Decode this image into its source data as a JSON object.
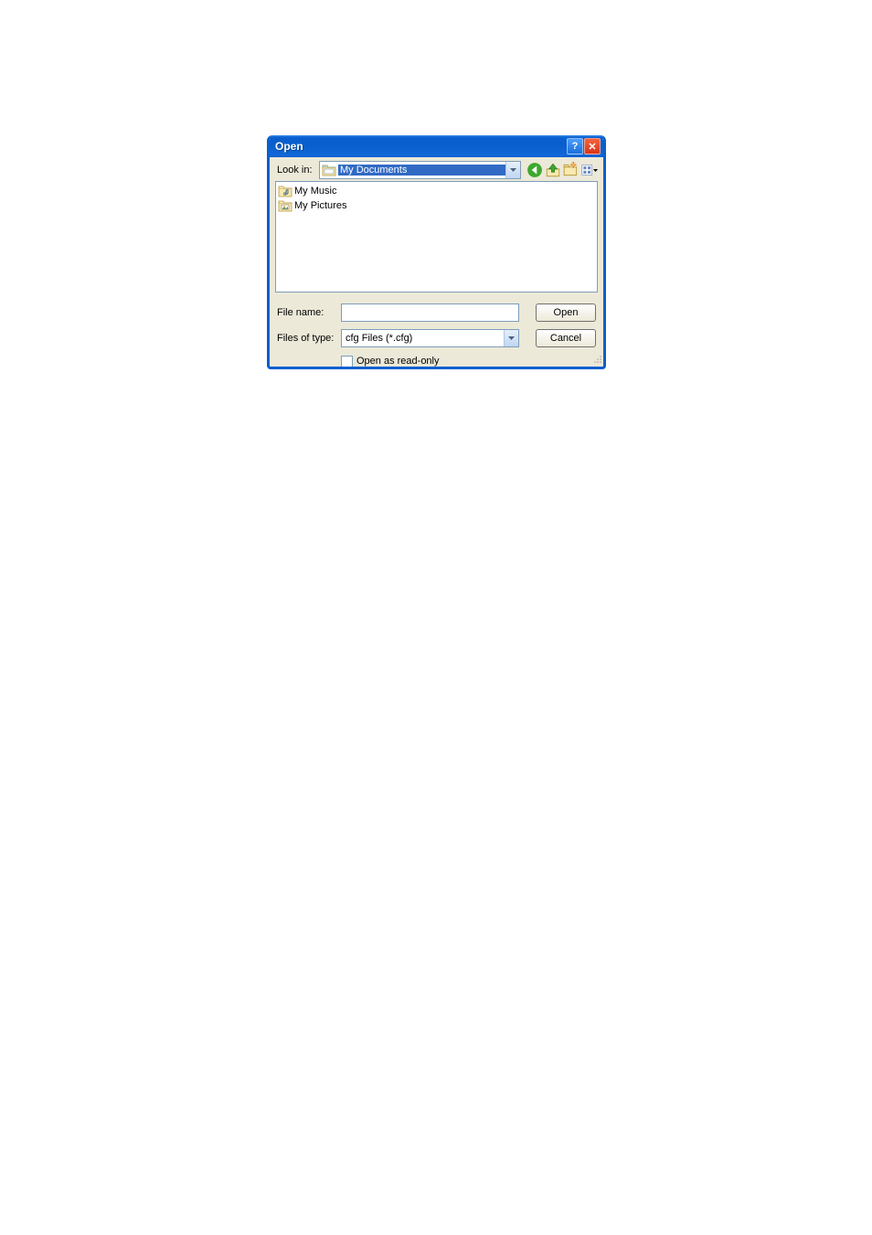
{
  "dialog": {
    "title": "Open",
    "lookin_label": "Look in:",
    "lookin_value": "My Documents",
    "file_items": [
      {
        "name": "My Music",
        "type": "folder-music"
      },
      {
        "name": "My Pictures",
        "type": "folder-pictures"
      }
    ],
    "file_name_label": "File name:",
    "file_name_value": "",
    "files_of_type_label": "Files of type:",
    "files_of_type_value": "cfg Files (*.cfg)",
    "open_button": "Open",
    "cancel_button": "Cancel",
    "readonly_label": "Open as read-only",
    "readonly_checked": false
  },
  "icons": {
    "help": "?",
    "close": "✕"
  }
}
